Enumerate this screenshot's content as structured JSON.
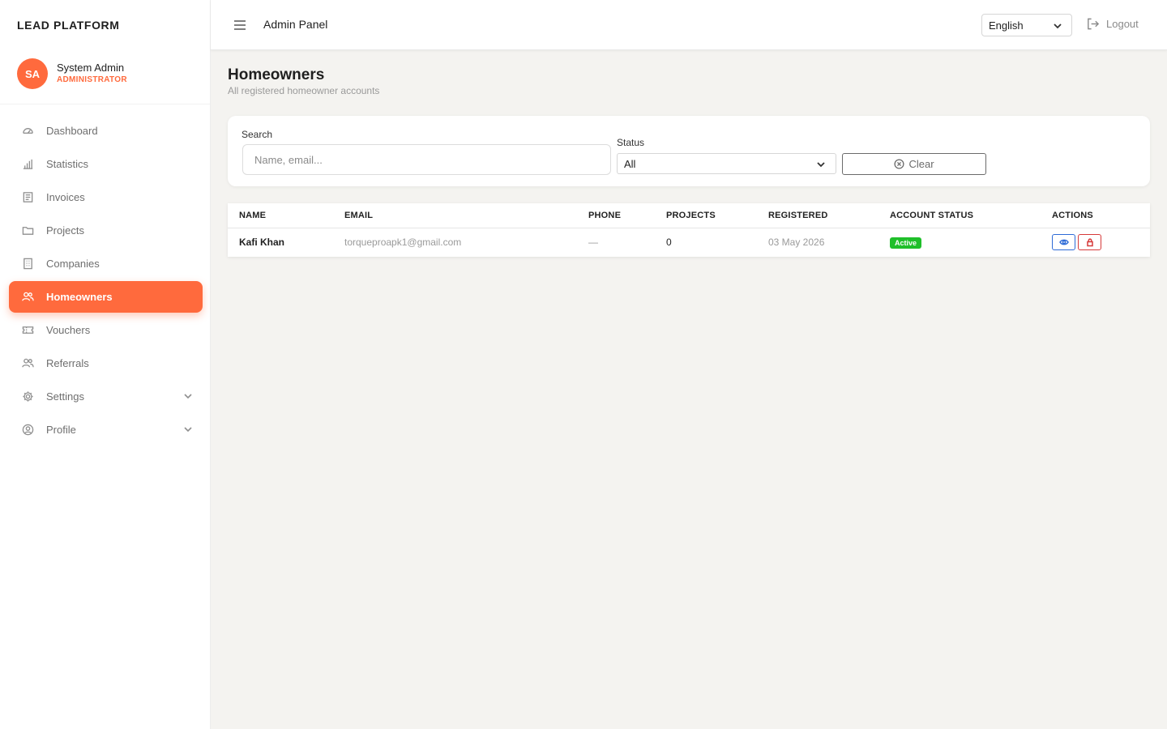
{
  "brand": "LEAD PLATFORM",
  "user": {
    "initials": "SA",
    "name": "System Admin",
    "role": "ADMINISTRATOR"
  },
  "topbar": {
    "title": "Admin Panel",
    "language": "English",
    "logout_label": "Logout"
  },
  "sidebar": {
    "items": [
      {
        "label": "Dashboard",
        "icon": "dashboard-icon"
      },
      {
        "label": "Statistics",
        "icon": "chart-icon"
      },
      {
        "label": "Invoices",
        "icon": "invoice-icon"
      },
      {
        "label": "Projects",
        "icon": "folder-icon"
      },
      {
        "label": "Companies",
        "icon": "building-icon"
      },
      {
        "label": "Homeowners",
        "icon": "users-icon",
        "active": true
      },
      {
        "label": "Vouchers",
        "icon": "ticket-icon"
      },
      {
        "label": "Referrals",
        "icon": "users-icon"
      },
      {
        "label": "Settings",
        "icon": "gear-icon",
        "expandable": true
      },
      {
        "label": "Profile",
        "icon": "user-circle-icon",
        "expandable": true
      }
    ]
  },
  "page": {
    "title": "Homeowners",
    "subtitle": "All registered homeowner accounts"
  },
  "filters": {
    "search_label": "Search",
    "search_placeholder": "Name, email...",
    "search_value": "",
    "status_label": "Status",
    "status_value": "All",
    "clear_label": "Clear"
  },
  "table": {
    "columns": [
      "NAME",
      "EMAIL",
      "PHONE",
      "PROJECTS",
      "REGISTERED",
      "ACCOUNT STATUS",
      "ACTIONS"
    ],
    "rows": [
      {
        "name": "Kafi Khan",
        "email": "torqueproapk1@gmail.com",
        "phone": "—",
        "projects": "0",
        "registered": "03 May 2026",
        "status": "Active"
      }
    ]
  },
  "colors": {
    "accent": "#ff6a3d",
    "active_badge": "#1fbf2a",
    "view_button": "#2e6bd6",
    "lock_button": "#d63a3a"
  }
}
